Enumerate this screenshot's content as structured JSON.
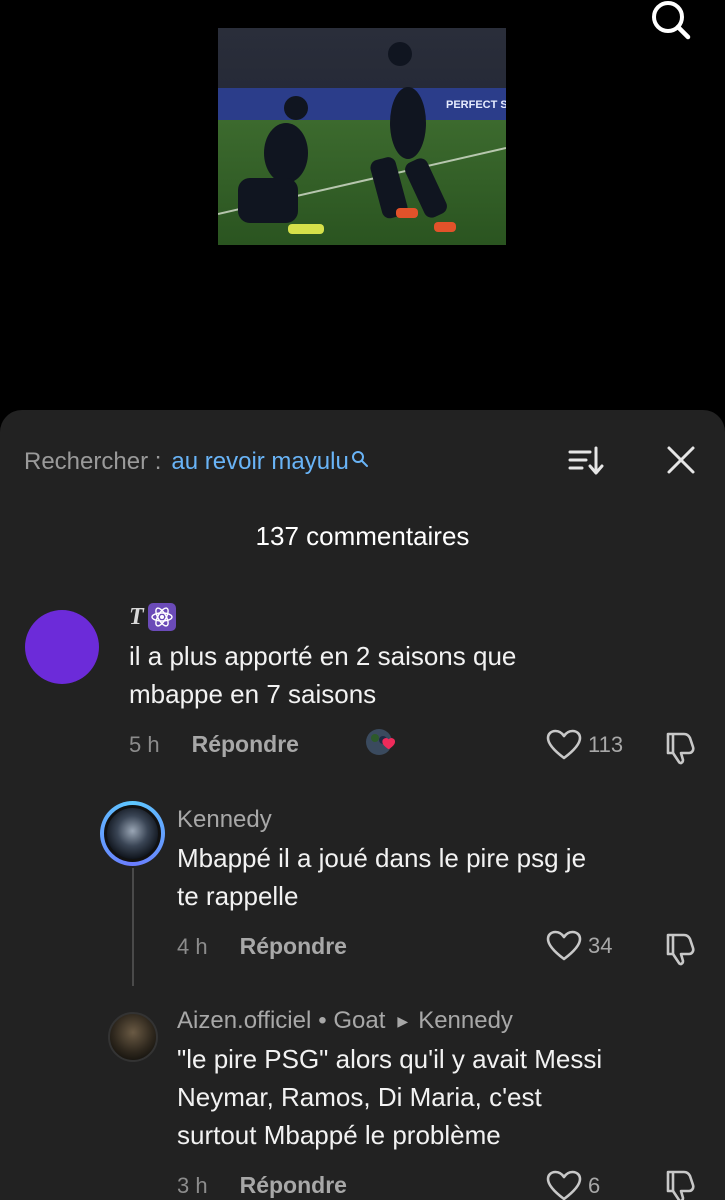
{
  "top": {
    "search_icon": "search-icon"
  },
  "video": {
    "banner_text": "PERFECT S"
  },
  "sheet": {
    "search_prefix": "Rechercher :",
    "search_query": "au revoir mayulu",
    "sort_icon": "sort-icon",
    "close_icon": "close-icon",
    "comment_count": "137 commentaires"
  },
  "comments": [
    {
      "username": "T",
      "text_lines": [
        "il a plus apporté en 2 saisons que",
        "mbappe en 7 saisons"
      ],
      "time": "5 h",
      "reply_label": "Répondre",
      "likes": "113",
      "avatar_color": "#6c2bd9"
    },
    {
      "username": "Kennedy",
      "text_lines": [
        "Mbappé il a joué dans le pire psg je",
        "te rappelle"
      ],
      "time": "4 h",
      "reply_label": "Répondre",
      "likes": "34"
    },
    {
      "username": "Aizen.officiel",
      "badge": "• Goat",
      "reply_to": "Kennedy",
      "text_lines": [
        "\"le pire PSG\" alors qu'il y avait Messi",
        "Neymar, Ramos, Di Maria, c'est",
        "surtout Mbappé le problème"
      ],
      "time": "3 h",
      "reply_label": "Répondre",
      "likes": "6"
    }
  ],
  "colors": {
    "accent_link": "#69b4f7",
    "sheet_bg": "#222222"
  }
}
